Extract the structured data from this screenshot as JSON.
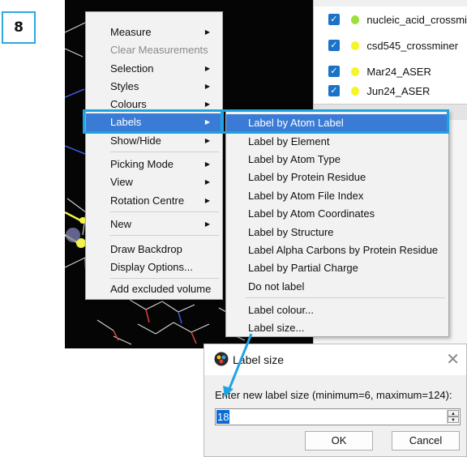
{
  "step_badge": "8",
  "structures": [
    {
      "label": "nucleic_acid_crossmi",
      "color": "#9be03a"
    },
    {
      "label": "csd545_crossminer",
      "color": "#f5f52a"
    },
    {
      "label": "Mar24_ASER",
      "color": "#f5f52a"
    },
    {
      "label": "Jun24_ASER",
      "color": "#f5f52a"
    }
  ],
  "checkmark": "✓",
  "context_menu": {
    "items": [
      {
        "label": "Measure",
        "submenu": true
      },
      {
        "label": "Clear Measurements",
        "disabled": true
      },
      {
        "label": "Selection",
        "submenu": true
      },
      {
        "label": "Styles",
        "submenu": true
      },
      {
        "label": "Colours",
        "submenu": true
      },
      {
        "label": "Labels",
        "submenu": true,
        "highlighted": true
      },
      {
        "label": "Show/Hide",
        "submenu": true
      },
      {
        "label": "Picking Mode",
        "submenu": true
      },
      {
        "label": "View",
        "submenu": true
      },
      {
        "label": "Rotation Centre",
        "submenu": true
      },
      {
        "label": "New",
        "submenu": true
      },
      {
        "label": "Draw Backdrop"
      },
      {
        "label": "Display Options..."
      },
      {
        "label": "Add excluded volume"
      }
    ],
    "arrow": "▶"
  },
  "labels_submenu": {
    "items": [
      {
        "label": "Label by Atom Label",
        "highlighted": true
      },
      {
        "label": "Label by Element"
      },
      {
        "label": "Label by Atom Type"
      },
      {
        "label": "Label by Protein Residue"
      },
      {
        "label": "Label by Atom File Index"
      },
      {
        "label": "Label by Atom Coordinates"
      },
      {
        "label": "Label by Structure"
      },
      {
        "label": "Label Alpha Carbons by Protein Residue"
      },
      {
        "label": "Label by Partial Charge"
      },
      {
        "label": "Do not label"
      },
      {
        "label": "Label colour..."
      },
      {
        "label": "Label size..."
      }
    ]
  },
  "dialog": {
    "title": "Label size",
    "close": "✕",
    "prompt": "Enter new label size (minimum=6, maximum=124):",
    "value": "18",
    "up": "▲",
    "down": "▼",
    "ok": "OK",
    "cancel": "Cancel"
  },
  "colors": {
    "highlight_box": "#1fa3e0",
    "menu_highlight": "#3a7bd5",
    "checkbox": "#1a73c6"
  }
}
